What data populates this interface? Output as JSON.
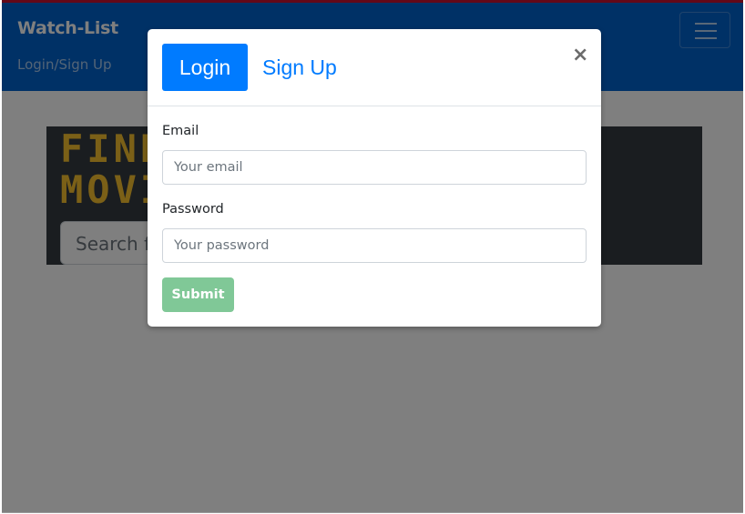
{
  "navbar": {
    "brand": "Watch-List",
    "link": "Login/Sign Up",
    "toggler_icon": "hamburger-icon"
  },
  "hero": {
    "title": "FIND THE BEST FREE MOVIES",
    "search_placeholder": "Search for"
  },
  "modal": {
    "tab_login": "Login",
    "tab_signup": "Sign Up",
    "close": "×",
    "email_label": "Email",
    "email_placeholder": "Your email",
    "email_value": "",
    "password_label": "Password",
    "password_placeholder": "Your password",
    "password_value": "",
    "submit": "Submit"
  },
  "colors": {
    "navbar_bg": "#0062cc",
    "accent": "#007bff",
    "hero_text": "#f6c02f",
    "submit_bg": "#80c897",
    "top_line": "#c8102e"
  }
}
